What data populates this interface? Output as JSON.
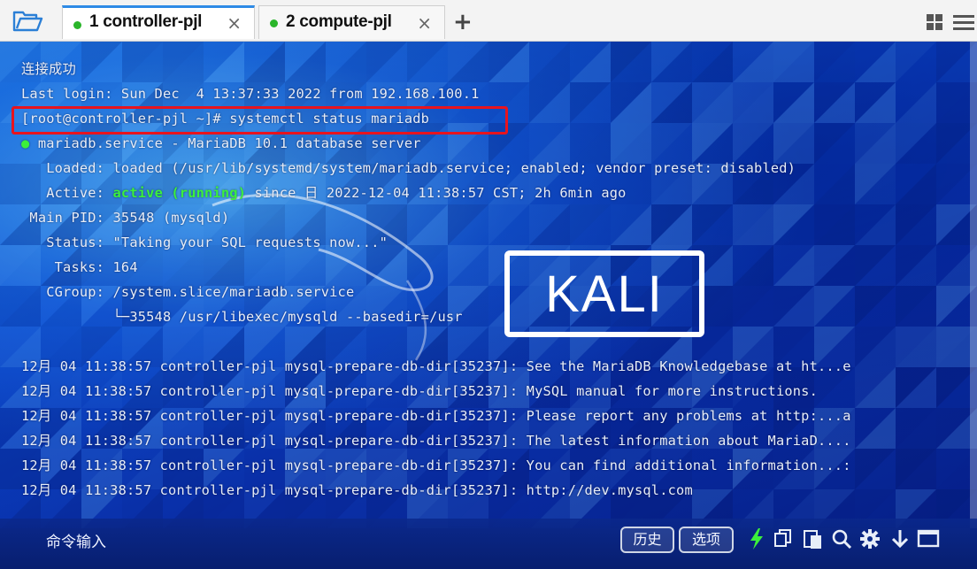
{
  "tabs": [
    {
      "label": "1 controller-pjl",
      "close": "×",
      "active": true
    },
    {
      "label": "2 compute-pjl",
      "close": "×",
      "active": false
    }
  ],
  "new_tab_label": "+",
  "terminal": {
    "lines": [
      "连接成功",
      "Last login: Sun Dec  4 13:37:33 2022 from 192.168.100.1",
      "[root@controller-pjl ~]# systemctl status mariadb",
      "mariadb.service - MariaDB 10.1 database server",
      "   Loaded: loaded (/usr/lib/systemd/system/mariadb.service; enabled; vendor preset: disabled)",
      "   Active: ",
      " Main PID: 35548 (mysqld)",
      "   Status: \"Taking your SQL requests now...\"",
      "    Tasks: 164",
      "   CGroup: /system.slice/mariadb.service",
      "           └─35548 /usr/libexec/mysqld --basedir=/usr",
      "12月 04 11:38:57 controller-pjl mysql-prepare-db-dir[35237]: See the MariaDB Knowledgebase at ht...e",
      "12月 04 11:38:57 controller-pjl mysql-prepare-db-dir[35237]: MySQL manual for more instructions.",
      "12月 04 11:38:57 controller-pjl mysql-prepare-db-dir[35237]: Please report any problems at http:...a",
      "12月 04 11:38:57 controller-pjl mysql-prepare-db-dir[35237]: The latest information about MariaD....",
      "12月 04 11:38:57 controller-pjl mysql-prepare-db-dir[35237]: You can find additional information...:",
      "12月 04 11:38:57 controller-pjl mysql-prepare-db-dir[35237]: http://dev.mysql.com"
    ],
    "status_dot": "●",
    "active_state": "active (running)",
    "active_since": " since 日 2022-12-04 11:38:57 CST; 2h 6min ago",
    "background_logo_text": "KALI"
  },
  "bottombar": {
    "command_input_label": "命令输入",
    "history_button": "历史",
    "options_button": "选项"
  },
  "icons": {
    "folder": "folder-open-icon",
    "layout": "layout-grid-icon",
    "menu": "hamburger-menu-icon",
    "lightning": "lightning-icon",
    "copy": "copy-icon",
    "paste": "paste-icon",
    "search": "search-icon",
    "settings": "gear-icon",
    "download": "arrow-down-icon",
    "window": "window-icon"
  },
  "colors": {
    "accent": "#2e8ae6",
    "status_green": "#3cf03c",
    "highlight_box": "#e8141e",
    "tab_dot": "#2ab52a"
  }
}
